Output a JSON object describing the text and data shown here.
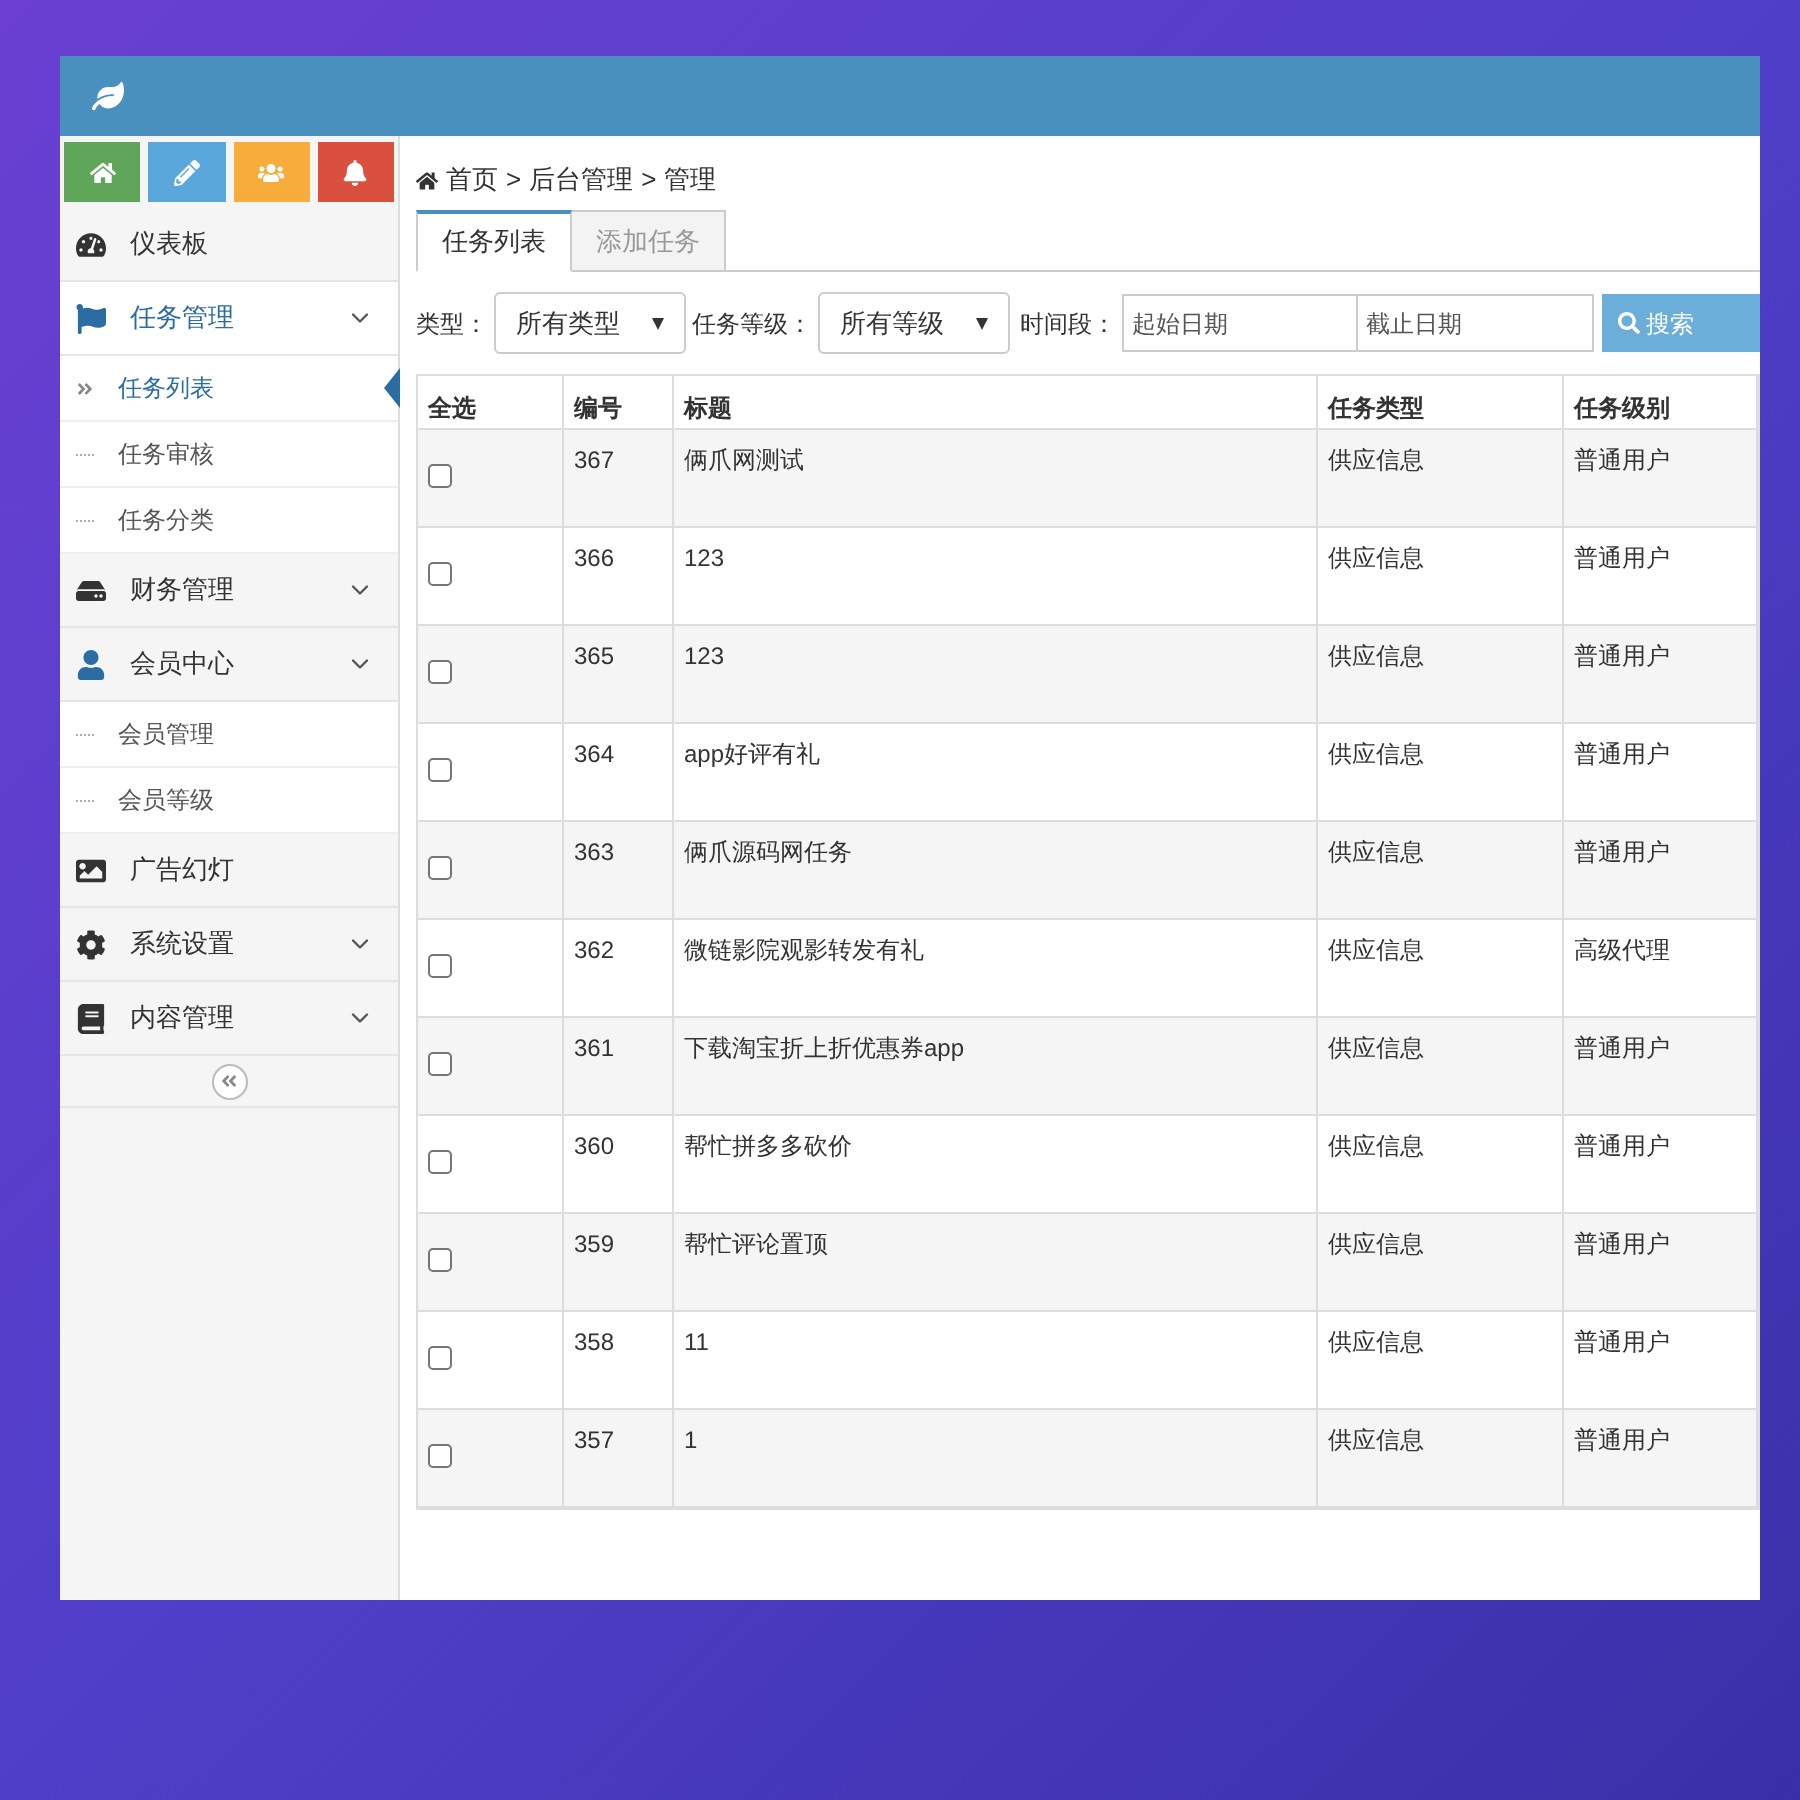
{
  "shortcuts": [
    {
      "color": "#5fa55a"
    },
    {
      "color": "#5aa7dc"
    },
    {
      "color": "#f7ac3b"
    },
    {
      "color": "#d9503f"
    }
  ],
  "sidebar": {
    "items": [
      {
        "kind": "link",
        "label": "仪表板",
        "selected": false
      },
      {
        "kind": "group",
        "label": "任务管理",
        "selected": true,
        "children": [
          {
            "label": "任务列表",
            "selected": true
          },
          {
            "label": "任务审核",
            "selected": false
          },
          {
            "label": "任务分类",
            "selected": false
          }
        ]
      },
      {
        "kind": "group",
        "label": "财务管理",
        "selected": false
      },
      {
        "kind": "group",
        "label": "会员中心",
        "selected": false,
        "children": [
          {
            "label": "会员管理",
            "selected": false
          },
          {
            "label": "会员等级",
            "selected": false
          }
        ]
      },
      {
        "kind": "link",
        "label": "广告幻灯",
        "selected": false
      },
      {
        "kind": "group",
        "label": "系统设置",
        "selected": false
      },
      {
        "kind": "group",
        "label": "内容管理",
        "selected": false
      }
    ]
  },
  "breadcrumb": [
    "首页",
    "后台管理",
    "管理"
  ],
  "breadcrumb_separator": ">",
  "tabs": [
    {
      "label": "任务列表",
      "selected": true
    },
    {
      "label": "添加任务",
      "selected": false
    }
  ],
  "filters": {
    "type_label": "类型：",
    "type_value": "所有类型",
    "level_label": "任务等级：",
    "level_value": "所有等级",
    "period_label": "时间段：",
    "start_placeholder": "起始日期",
    "end_placeholder": "截止日期",
    "search_button": "搜索"
  },
  "table": {
    "columns": [
      "全选",
      "编号",
      "标题",
      "任务类型",
      "任务级别"
    ],
    "rows": [
      {
        "checked": false,
        "cells": [
          "",
          "367",
          "俩爪网测试",
          "供应信息",
          "普通用户"
        ]
      },
      {
        "checked": false,
        "cells": [
          "",
          "366",
          "123",
          "供应信息",
          "普通用户"
        ]
      },
      {
        "checked": false,
        "cells": [
          "",
          "365",
          "123",
          "供应信息",
          "普通用户"
        ]
      },
      {
        "checked": false,
        "cells": [
          "",
          "364",
          "app好评有礼",
          "供应信息",
          "普通用户"
        ]
      },
      {
        "checked": false,
        "cells": [
          "",
          "363",
          "俩爪源码网任务",
          "供应信息",
          "普通用户"
        ]
      },
      {
        "checked": false,
        "cells": [
          "",
          "362",
          "微链影院观影转发有礼",
          "供应信息",
          "高级代理"
        ]
      },
      {
        "checked": false,
        "cells": [
          "",
          "361",
          "下载淘宝折上折优惠券app",
          "供应信息",
          "普通用户"
        ]
      },
      {
        "checked": false,
        "cells": [
          "",
          "360",
          "帮忙拼多多砍价",
          "供应信息",
          "普通用户"
        ]
      },
      {
        "checked": false,
        "cells": [
          "",
          "359",
          "帮忙评论置顶",
          "供应信息",
          "普通用户"
        ]
      },
      {
        "checked": false,
        "cells": [
          "",
          "358",
          "11",
          "供应信息",
          "普通用户"
        ]
      },
      {
        "checked": false,
        "cells": [
          "",
          "357",
          "1",
          "供应信息",
          "普通用户"
        ]
      }
    ]
  }
}
